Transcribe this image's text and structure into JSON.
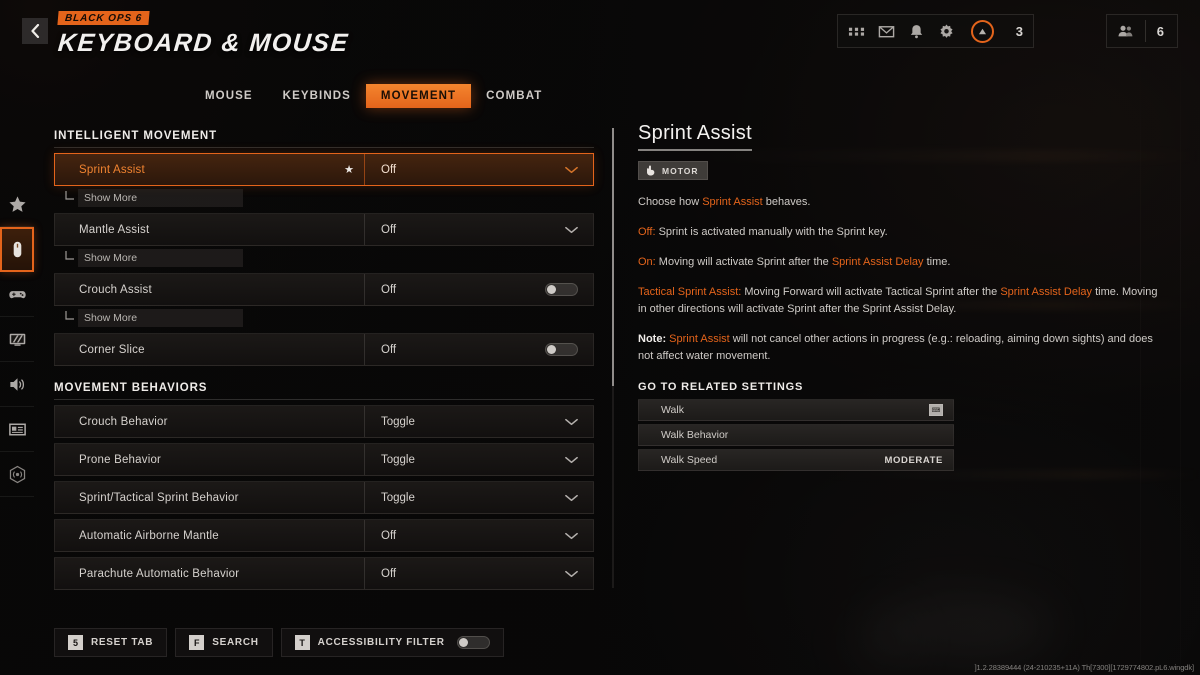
{
  "header": {
    "back_icon": "chevron-left-icon",
    "game_badge": "BLACK OPS 6",
    "page_title": "KEYBOARD & MOUSE",
    "hud": {
      "icons": [
        "grid-icon",
        "mail-icon",
        "bell-icon",
        "gear-icon"
      ],
      "battlepass_icon": "triangle-ring-icon",
      "battlepass_count": "3",
      "friends_icon": "friends-icon",
      "friends_count": "6"
    }
  },
  "rail": {
    "items": [
      {
        "name": "favorites",
        "icon": "star-icon",
        "active": false
      },
      {
        "name": "keyboard-mouse",
        "icon": "mouse-icon",
        "active": true
      },
      {
        "name": "controller",
        "icon": "gamepad-icon",
        "active": false
      },
      {
        "name": "graphics",
        "icon": "monitor-icon",
        "active": false
      },
      {
        "name": "audio",
        "icon": "speaker-icon",
        "active": false
      },
      {
        "name": "account",
        "icon": "account-card-icon",
        "active": false
      },
      {
        "name": "network",
        "icon": "network-icon",
        "active": false
      }
    ]
  },
  "tabs": [
    {
      "label": "MOUSE",
      "active": false
    },
    {
      "label": "KEYBINDS",
      "active": false
    },
    {
      "label": "MOVEMENT",
      "active": true
    },
    {
      "label": "COMBAT",
      "active": false
    }
  ],
  "settings": {
    "sections": [
      {
        "heading": "INTELLIGENT MOVEMENT",
        "rows": [
          {
            "label": "Sprint Assist",
            "value": "Off",
            "control": "dropdown",
            "selected": true,
            "starred": true,
            "sub": "Show More"
          },
          {
            "label": "Mantle Assist",
            "value": "Off",
            "control": "dropdown",
            "selected": false,
            "starred": false,
            "sub": "Show More"
          },
          {
            "label": "Crouch Assist",
            "value": "Off",
            "control": "toggle",
            "selected": false,
            "starred": false,
            "sub": "Show More"
          },
          {
            "label": "Corner Slice",
            "value": "Off",
            "control": "toggle",
            "selected": false,
            "starred": false,
            "sub": null
          }
        ]
      },
      {
        "heading": "MOVEMENT BEHAVIORS",
        "rows": [
          {
            "label": "Crouch Behavior",
            "value": "Toggle",
            "control": "dropdown",
            "selected": false,
            "starred": false,
            "sub": null
          },
          {
            "label": "Prone Behavior",
            "value": "Toggle",
            "control": "dropdown",
            "selected": false,
            "starred": false,
            "sub": null
          },
          {
            "label": "Sprint/Tactical Sprint Behavior",
            "value": "Toggle",
            "control": "dropdown",
            "selected": false,
            "starred": false,
            "sub": null
          },
          {
            "label": "Automatic Airborne Mantle",
            "value": "Off",
            "control": "dropdown",
            "selected": false,
            "starred": false,
            "sub": null
          },
          {
            "label": "Parachute Automatic Behavior",
            "value": "Off",
            "control": "dropdown",
            "selected": false,
            "starred": false,
            "sub": null
          }
        ]
      }
    ]
  },
  "detail": {
    "title": "Sprint Assist",
    "tag": {
      "icon": "hand-accessibility-icon",
      "label": "MOTOR"
    },
    "paragraphs": [
      {
        "id": "p_intro",
        "segments": [
          {
            "text": "Choose how ",
            "style": "normal"
          },
          {
            "text": "Sprint Assist",
            "style": "highlight"
          },
          {
            "text": " behaves.",
            "style": "normal"
          }
        ]
      },
      {
        "id": "p_off",
        "segments": [
          {
            "text": "Off:",
            "style": "highlight"
          },
          {
            "text": " Sprint is activated manually with the Sprint key.",
            "style": "normal"
          }
        ]
      },
      {
        "id": "p_on",
        "segments": [
          {
            "text": "On:",
            "style": "highlight"
          },
          {
            "text": " Moving will activate Sprint after the ",
            "style": "normal"
          },
          {
            "text": "Sprint Assist Delay",
            "style": "highlight"
          },
          {
            "text": " time.",
            "style": "normal"
          }
        ]
      },
      {
        "id": "p_tactical",
        "segments": [
          {
            "text": "Tactical Sprint Assist:",
            "style": "highlight"
          },
          {
            "text": " Moving Forward will activate Tactical Sprint after the ",
            "style": "normal"
          },
          {
            "text": "Sprint Assist Delay",
            "style": "highlight"
          },
          {
            "text": " time. Moving in other directions will activate Sprint after the Sprint Assist Delay.",
            "style": "normal"
          }
        ]
      },
      {
        "id": "p_note",
        "segments": [
          {
            "text": "Note:",
            "style": "note"
          },
          {
            "text": " ",
            "style": "normal"
          },
          {
            "text": "Sprint Assist",
            "style": "highlight"
          },
          {
            "text": " will not cancel other actions in progress (e.g.: reloading, aiming down sights) and does not affect water movement.",
            "style": "normal"
          }
        ]
      }
    ],
    "related_heading": "GO TO RELATED SETTINGS",
    "related": [
      {
        "label": "Walk",
        "value": "",
        "has_keycap": true,
        "keycap": "⌨"
      },
      {
        "label": "Walk Behavior",
        "value": "",
        "has_keycap": false,
        "keycap": ""
      },
      {
        "label": "Walk Speed",
        "value": "MODERATE",
        "has_keycap": false,
        "keycap": ""
      }
    ]
  },
  "actionbar": [
    {
      "key": "5",
      "label": "RESET TAB",
      "toggle": false
    },
    {
      "key": "F",
      "label": "SEARCH",
      "toggle": false
    },
    {
      "key": "T",
      "label": "ACCESSIBILITY FILTER",
      "toggle": true
    }
  ],
  "build_string": "]1.2.28389444 (24-210235+11A) Th[7300][1729774802.pL6.wingdk]",
  "colors": {
    "accent": "#e4641b",
    "text_primary": "#efece9",
    "text_secondary": "#cfcbc7",
    "panel_bg": "#14120f"
  }
}
